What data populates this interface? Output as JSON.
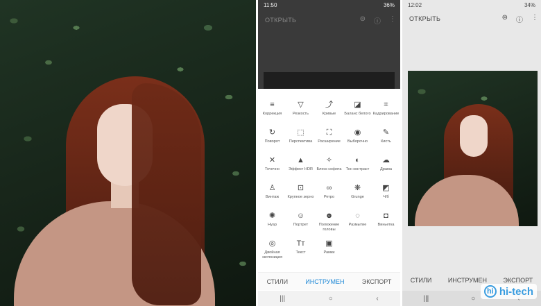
{
  "mid_phone": {
    "status": {
      "time": "11:50",
      "battery": "36%"
    },
    "header": {
      "open_label": "ОТКРЫТЬ"
    },
    "tools": [
      {
        "label": "Коррекция",
        "icon": "≡"
      },
      {
        "label": "Резкость",
        "icon": "▽"
      },
      {
        "label": "Кривые",
        "icon": "⤴"
      },
      {
        "label": "Баланс белого",
        "icon": "◪"
      },
      {
        "label": "Кадрирование",
        "icon": "⌗"
      },
      {
        "label": "Поворот",
        "icon": "↻"
      },
      {
        "label": "Перспектива",
        "icon": "⬚"
      },
      {
        "label": "Расширение",
        "icon": "⛶"
      },
      {
        "label": "Выборочно",
        "icon": "◉"
      },
      {
        "label": "Кисть",
        "icon": "✎"
      },
      {
        "label": "Точечно",
        "icon": "✕"
      },
      {
        "label": "Эффект HDR",
        "icon": "▲"
      },
      {
        "label": "Блеск софита",
        "icon": "✧"
      },
      {
        "label": "Тон контраст",
        "icon": "◐"
      },
      {
        "label": "Драма",
        "icon": "☁"
      },
      {
        "label": "Винтаж",
        "icon": "♙"
      },
      {
        "label": "Крупное зерно",
        "icon": "⊡"
      },
      {
        "label": "Ретро",
        "icon": "∞"
      },
      {
        "label": "Grunge",
        "icon": "❋"
      },
      {
        "label": "Ч/б",
        "icon": "◩"
      },
      {
        "label": "Нуар",
        "icon": "✺"
      },
      {
        "label": "Портрет",
        "icon": "☺"
      },
      {
        "label": "Положение головы",
        "icon": "☻"
      },
      {
        "label": "Размытие",
        "icon": "◌"
      },
      {
        "label": "Виньетка",
        "icon": "◘"
      },
      {
        "label": "Двойная экспозиция",
        "icon": "◎"
      },
      {
        "label": "Текст",
        "icon": "Tт"
      },
      {
        "label": "Рамки",
        "icon": "▣"
      }
    ],
    "tabs": {
      "styles": "СТИЛИ",
      "tools": "ИНСТРУМЕН",
      "export": "ЭКСПОРТ"
    },
    "nav": {
      "recent": "|||",
      "home": "○",
      "back": "‹"
    }
  },
  "right_phone": {
    "status": {
      "time": "12:02",
      "battery": "34%"
    },
    "header": {
      "open_label": "ОТКРЫТЬ"
    },
    "tabs": {
      "styles": "СТИЛИ",
      "tools": "ИНСТРУМЕН",
      "export": "ЭКСПОРТ"
    },
    "nav": {
      "recent": "|||",
      "home": "○",
      "back": "‹"
    }
  },
  "watermark": {
    "text": "hi-tech",
    "icon": "hi"
  },
  "colors": {
    "accent": "#1e88d6",
    "dark_header": "#3a3a3a"
  }
}
